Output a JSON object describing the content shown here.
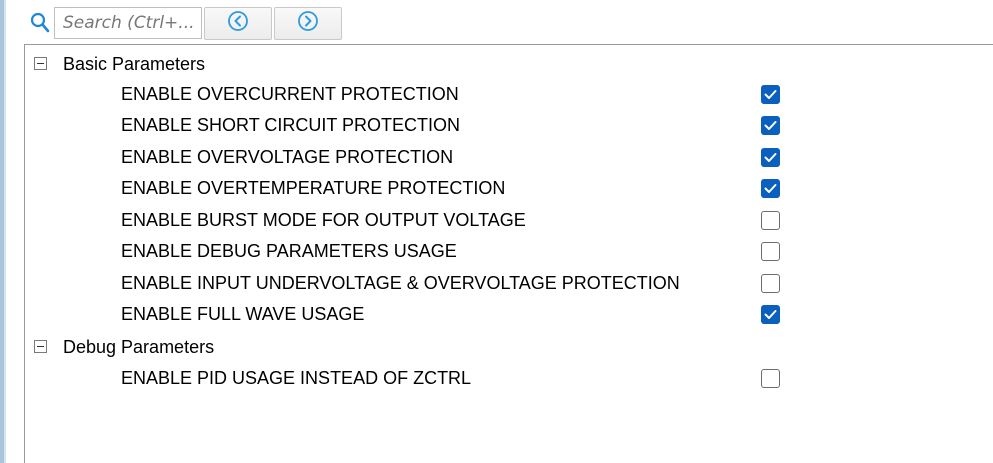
{
  "search": {
    "placeholder": "Search (Ctrl+..."
  },
  "toolbar": {
    "search_icon": "search-icon",
    "prev_icon": "circle-chevron-left-icon",
    "next_icon": "circle-chevron-right-icon"
  },
  "groups": [
    {
      "label": "Basic Parameters",
      "expanded": true,
      "params": [
        {
          "label": "ENABLE OVERCURRENT PROTECTION",
          "checked": true
        },
        {
          "label": "ENABLE SHORT CIRCUIT PROTECTION",
          "checked": true
        },
        {
          "label": "ENABLE OVERVOLTAGE PROTECTION",
          "checked": true
        },
        {
          "label": "ENABLE OVERTEMPERATURE PROTECTION",
          "checked": true
        },
        {
          "label": "ENABLE BURST MODE FOR OUTPUT VOLTAGE",
          "checked": false
        },
        {
          "label": "ENABLE DEBUG PARAMETERS USAGE",
          "checked": false
        },
        {
          "label": "ENABLE INPUT UNDERVOLTAGE & OVERVOLTAGE PROTECTION",
          "checked": false
        },
        {
          "label": "ENABLE FULL WAVE USAGE",
          "checked": true
        }
      ]
    },
    {
      "label": "Debug Parameters",
      "expanded": true,
      "params": [
        {
          "label": "ENABLE PID USAGE INSTEAD OF ZCTRL",
          "checked": false
        }
      ]
    }
  ],
  "colors": {
    "checkbox_checked": "#0a5fbf",
    "search_icon": "#1e88d8",
    "nav_icon": "#2d9be0"
  }
}
